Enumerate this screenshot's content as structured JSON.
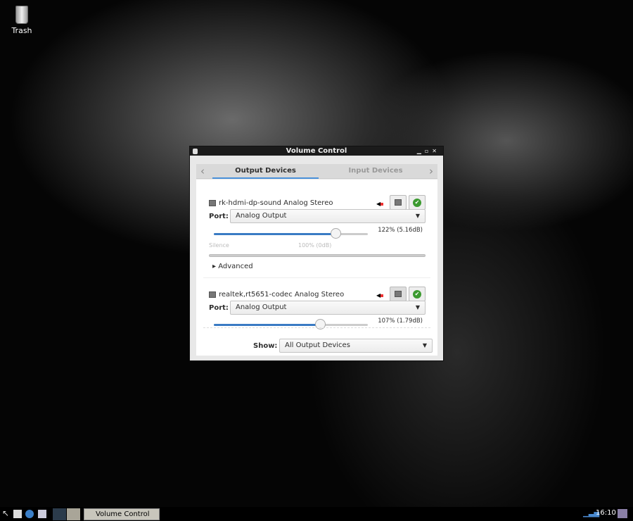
{
  "desktop": {
    "icons": [
      {
        "label": "Trash",
        "icon": "trash-icon"
      }
    ]
  },
  "window": {
    "title": "Volume Control",
    "controls": [
      "minimize",
      "maximize",
      "close"
    ],
    "tabs": [
      {
        "label": "Output Devices",
        "active": true
      },
      {
        "label": "Input Devices",
        "active": false
      }
    ],
    "devices": [
      {
        "name": "rk-hdmi-dp-sound Analog Stereo",
        "port_label": "Port:",
        "port": "Analog Output",
        "volume_percent": 122,
        "volume_text": "122% (5.16dB)",
        "tick_silence": "Silence",
        "tick_100": "100% (0dB)",
        "advanced_label": "Advanced",
        "muted": false,
        "fallback": true
      },
      {
        "name": "realtek,rt5651-codec Analog Stereo",
        "port_label": "Port:",
        "port": "Analog Output",
        "volume_percent": 107,
        "volume_text": "107% (1.79dB)",
        "muted": false,
        "fallback": true
      }
    ],
    "show_label": "Show:",
    "show_value": "All Output Devices"
  },
  "taskbar": {
    "task_label": "Volume Control",
    "clock": "16:10"
  },
  "colors": {
    "accent": "#4a90d9",
    "slider_fill": "#3a7bc4",
    "check": "#3c9a30"
  }
}
